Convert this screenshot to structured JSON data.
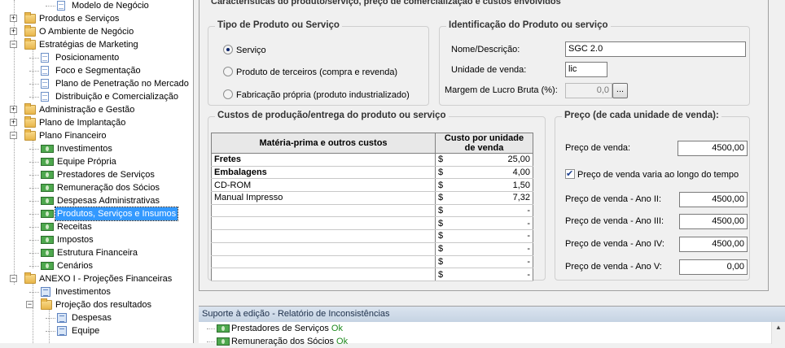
{
  "tree": {
    "items": [
      {
        "label": "Modelo de Negócio",
        "level": 2,
        "icon": "doc-icon",
        "expander": ""
      },
      {
        "label": "Produtos e Serviços",
        "level": 0,
        "icon": "folder-icon",
        "expander": "+"
      },
      {
        "label": "O Ambiente de Negócio",
        "level": 0,
        "icon": "folder-icon",
        "expander": "+"
      },
      {
        "label": "Estratégias de Marketing",
        "level": 0,
        "icon": "folder-icon",
        "expander": "−"
      },
      {
        "label": "Posicionamento",
        "level": 1,
        "icon": "doc-icon",
        "expander": ""
      },
      {
        "label": "Foco e Segmentação",
        "level": 1,
        "icon": "doc-icon",
        "expander": ""
      },
      {
        "label": "Plano de Penetração no Mercado",
        "level": 1,
        "icon": "doc-icon",
        "expander": ""
      },
      {
        "label": "Distribuição e Comercialização",
        "level": 1,
        "icon": "doc-icon",
        "expander": ""
      },
      {
        "label": "Administração e Gestão",
        "level": 0,
        "icon": "folder-icon",
        "expander": "+"
      },
      {
        "label": "Plano de Implantação",
        "level": 0,
        "icon": "folder-icon",
        "expander": "+"
      },
      {
        "label": "Plano Financeiro",
        "level": 0,
        "icon": "folder-icon",
        "expander": "−"
      },
      {
        "label": "Investimentos",
        "level": 1,
        "icon": "money-icon",
        "expander": ""
      },
      {
        "label": "Equipe Própria",
        "level": 1,
        "icon": "money-icon",
        "expander": ""
      },
      {
        "label": "Prestadores de Serviços",
        "level": 1,
        "icon": "money-icon",
        "expander": ""
      },
      {
        "label": "Remuneração dos Sócios",
        "level": 1,
        "icon": "money-icon",
        "expander": ""
      },
      {
        "label": "Despesas Administrativas",
        "level": 1,
        "icon": "money-icon",
        "expander": ""
      },
      {
        "label": "Produtos, Serviços e Insumos",
        "level": 1,
        "icon": "money-icon",
        "expander": "",
        "selected": true
      },
      {
        "label": "Receitas",
        "level": 1,
        "icon": "money-icon",
        "expander": ""
      },
      {
        "label": "Impostos",
        "level": 1,
        "icon": "money-icon",
        "expander": ""
      },
      {
        "label": "Estrutura Financeira",
        "level": 1,
        "icon": "money-icon",
        "expander": ""
      },
      {
        "label": "Cenários",
        "level": 1,
        "icon": "money-icon",
        "expander": ""
      },
      {
        "label": "ANEXO I - Projeções Financeiras",
        "level": 0,
        "icon": "folder-icon",
        "expander": "−"
      },
      {
        "label": "Investimentos",
        "level": 1,
        "icon": "grid-icon",
        "expander": ""
      },
      {
        "label": "Projeção dos resultados",
        "level": 1,
        "icon": "folder-icon",
        "expander": "−"
      },
      {
        "label": "Despesas",
        "level": 2,
        "icon": "grid-icon",
        "expander": ""
      },
      {
        "label": "Equipe",
        "level": 2,
        "icon": "grid-icon",
        "expander": ""
      }
    ]
  },
  "main": {
    "section_title": "Características do produto/serviço, preço de comercialização e custos envolvidos",
    "tipo": {
      "title": "Tipo de Produto ou Serviço",
      "options": [
        {
          "label": "Serviço",
          "checked": true
        },
        {
          "label": "Produto de terceiros (compra e revenda)",
          "checked": false
        },
        {
          "label": "Fabricação própria (produto industrializado)",
          "checked": false
        }
      ]
    },
    "identificacao": {
      "title": "Identificação do Produto ou serviço",
      "nome_label": "Nome/Descrição:",
      "nome_value": "SGC 2.0",
      "unidade_label": "Unidade de venda:",
      "unidade_value": "lic",
      "margem_label": "Margem de Lucro Bruta (%):",
      "margem_value": "0,0",
      "margem_button": "..."
    },
    "custos": {
      "title": "Custos de produção/entrega do produto ou serviço",
      "headers": [
        "Matéria-prima e outros custos",
        "Custo por unidade de venda"
      ],
      "currency": "$",
      "rows": [
        {
          "item": "Fretes",
          "value": "25,00",
          "bold": true
        },
        {
          "item": "Embalagens",
          "value": "4,00",
          "bold": true
        },
        {
          "item": "CD-ROM",
          "value": "1,50",
          "bold": false
        },
        {
          "item": "Manual Impresso",
          "value": "7,32",
          "bold": false
        },
        {
          "item": "",
          "value": "-",
          "bold": false
        },
        {
          "item": "",
          "value": "-",
          "bold": false
        },
        {
          "item": "",
          "value": "-",
          "bold": false
        },
        {
          "item": "",
          "value": "-",
          "bold": false
        },
        {
          "item": "",
          "value": "-",
          "bold": false
        },
        {
          "item": "",
          "value": "-",
          "bold": false
        }
      ]
    },
    "preco": {
      "title": "Preço (de cada unidade de venda):",
      "venda_label": "Preço de venda:",
      "venda_value": "4500,00",
      "varia_label": "Preço de venda varia ao longo do tempo",
      "varia_checked": true,
      "anos": [
        {
          "label": "Preço de venda - Ano II:",
          "value": "4500,00"
        },
        {
          "label": "Preço de venda - Ano III:",
          "value": "4500,00"
        },
        {
          "label": "Preço de venda - Ano IV:",
          "value": "4500,00"
        },
        {
          "label": "Preço de venda - Ano V:",
          "value": "0,00"
        }
      ]
    }
  },
  "bottom": {
    "title": "Suporte à edição - Relatório de Inconsistências",
    "items": [
      {
        "label": "Prestadores de Serviços",
        "status": "Ok"
      },
      {
        "label": "Remuneração dos Sócios",
        "status": "Ok"
      }
    ]
  }
}
